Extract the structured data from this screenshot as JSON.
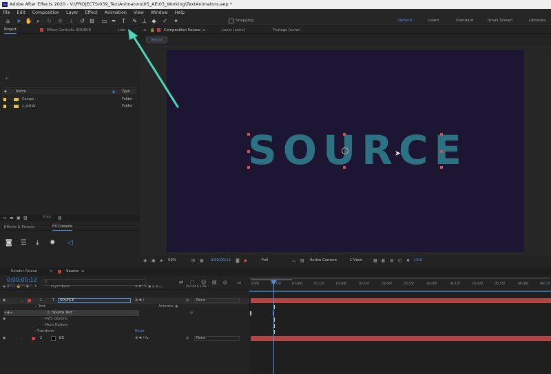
{
  "window": {
    "title": "Adobe After Effects 2020 - V:\\PROJECTS\\039_TextAnimators\\05_AE\\03_Working\\TextAnimators.aep *",
    "logo": "Ae"
  },
  "menu": [
    "File",
    "Edit",
    "Composition",
    "Layer",
    "Effect",
    "Animation",
    "View",
    "Window",
    "Help"
  ],
  "toolbar": {
    "snapping_label": "Snapping",
    "workspaces": [
      "Default",
      "Learn",
      "Standard",
      "Small Screen",
      "Libraries"
    ],
    "active_workspace": "Default"
  },
  "project_panel": {
    "tabs": [
      "Project",
      "Effect Controls: SOURCE",
      "Info"
    ],
    "search_icon": "search-icon",
    "columns": {
      "name": "Name",
      "type": "Type"
    },
    "items": [
      {
        "name": "Comps",
        "type": "Folder"
      },
      {
        "name": "z_solids",
        "type": "Folder"
      }
    ],
    "bpc": "8 bpc"
  },
  "effects_panel": {
    "tabs": [
      "Effects & Presets",
      "FX Console"
    ]
  },
  "comp_panel": {
    "tabs": [
      "Composition Source",
      "Layer (none)",
      "Footage (none)"
    ],
    "breadcrumb": "Source",
    "text": "SOURCE",
    "canvas_color": "#1d1632",
    "text_color": "#2c7282"
  },
  "viewer_bar": {
    "zoom": "50%",
    "timecode": "0;00;00;12",
    "resolution": "Full",
    "camera": "Active Camera",
    "views": "1 View",
    "exposure": "+0.0"
  },
  "timeline": {
    "tabs": [
      "Render Queue",
      "Source"
    ],
    "timecode": "0;00;00;12",
    "fps_note": "00012 (29.97 fps)",
    "ruler": [
      "0:00f",
      "00:15f",
      "01:00f",
      "01:15f",
      "02:00f",
      "02:15f",
      "03:00f",
      "03:15f",
      "04:00f",
      "04:15f",
      "05:00f",
      "05:15f",
      "06:00f",
      "06:15f"
    ],
    "columns": {
      "layer_name": "Layer Name",
      "parent": "Parent & Link"
    },
    "layers": [
      {
        "num": "1",
        "type": "T",
        "name": "SOURCE",
        "parent": "None",
        "color": "#c63f3f"
      },
      {
        "num": "2",
        "type": "",
        "name": "BG",
        "parent": "None",
        "color": "#c63f3f"
      }
    ],
    "props": {
      "text": "Text",
      "animate": "Animate:",
      "source_text": "Source Text",
      "path_options": "Path Options",
      "more_options": "More Options",
      "transform": "Transform",
      "reset": "Reset"
    }
  }
}
